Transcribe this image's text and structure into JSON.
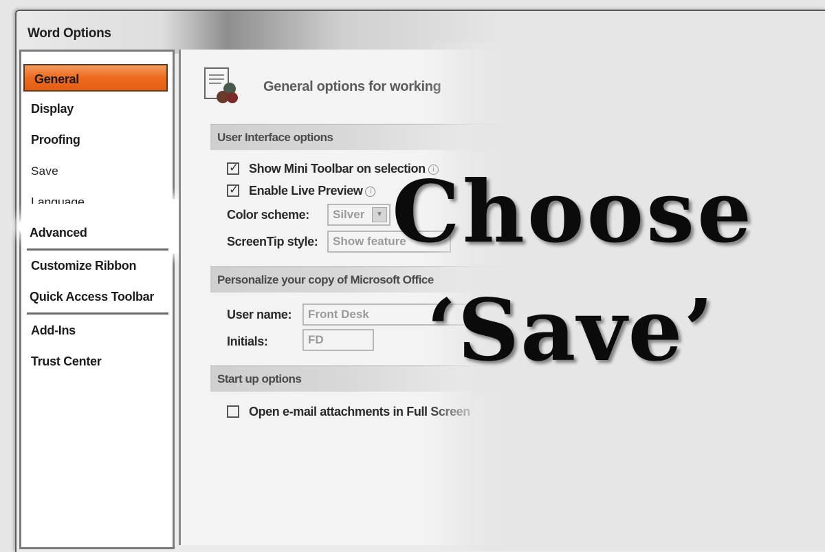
{
  "window": {
    "title": "Word Options"
  },
  "nav": {
    "items": [
      {
        "label": "General"
      },
      {
        "label": "Display"
      },
      {
        "label": "Proofing"
      },
      {
        "label": "Save"
      },
      {
        "label": "Language"
      },
      {
        "label": "Advanced"
      },
      {
        "label": "Customize Ribbon"
      },
      {
        "label": "Quick Access Toolbar"
      },
      {
        "label": "Add-Ins"
      },
      {
        "label": "Trust Center"
      }
    ],
    "selected": "General",
    "highlighted": "Save"
  },
  "content": {
    "header": "General options for working",
    "sections": [
      {
        "title": "User Interface options"
      },
      {
        "title": "Personalize your copy of Microsoft Office"
      },
      {
        "title": "Start up options"
      }
    ],
    "ui_options": {
      "mini_toolbar_label": "Show Mini Toolbar on selection",
      "mini_toolbar_checked": true,
      "live_preview_label": "Enable Live Preview",
      "live_preview_checked": true,
      "color_scheme_label": "Color scheme:",
      "color_scheme_value": "Silver",
      "screentip_label": "ScreenTip style:",
      "screentip_value": "Show feature"
    },
    "personalize": {
      "user_name_label": "User name:",
      "user_name_value": "Front Desk",
      "initials_label": "Initials:",
      "initials_value": "FD"
    },
    "startup": {
      "open_attachments_label": "Open e-mail attachments in Full Screen",
      "open_attachments_checked": false
    }
  },
  "overlay": {
    "line1": "Choose",
    "line2": "‘Save’"
  },
  "colors": {
    "selected_accent": "#ec6b1f"
  },
  "icons": [
    "general-options-icon",
    "info-icon",
    "dropdown-arrow-icon",
    "checkmark-icon"
  ]
}
